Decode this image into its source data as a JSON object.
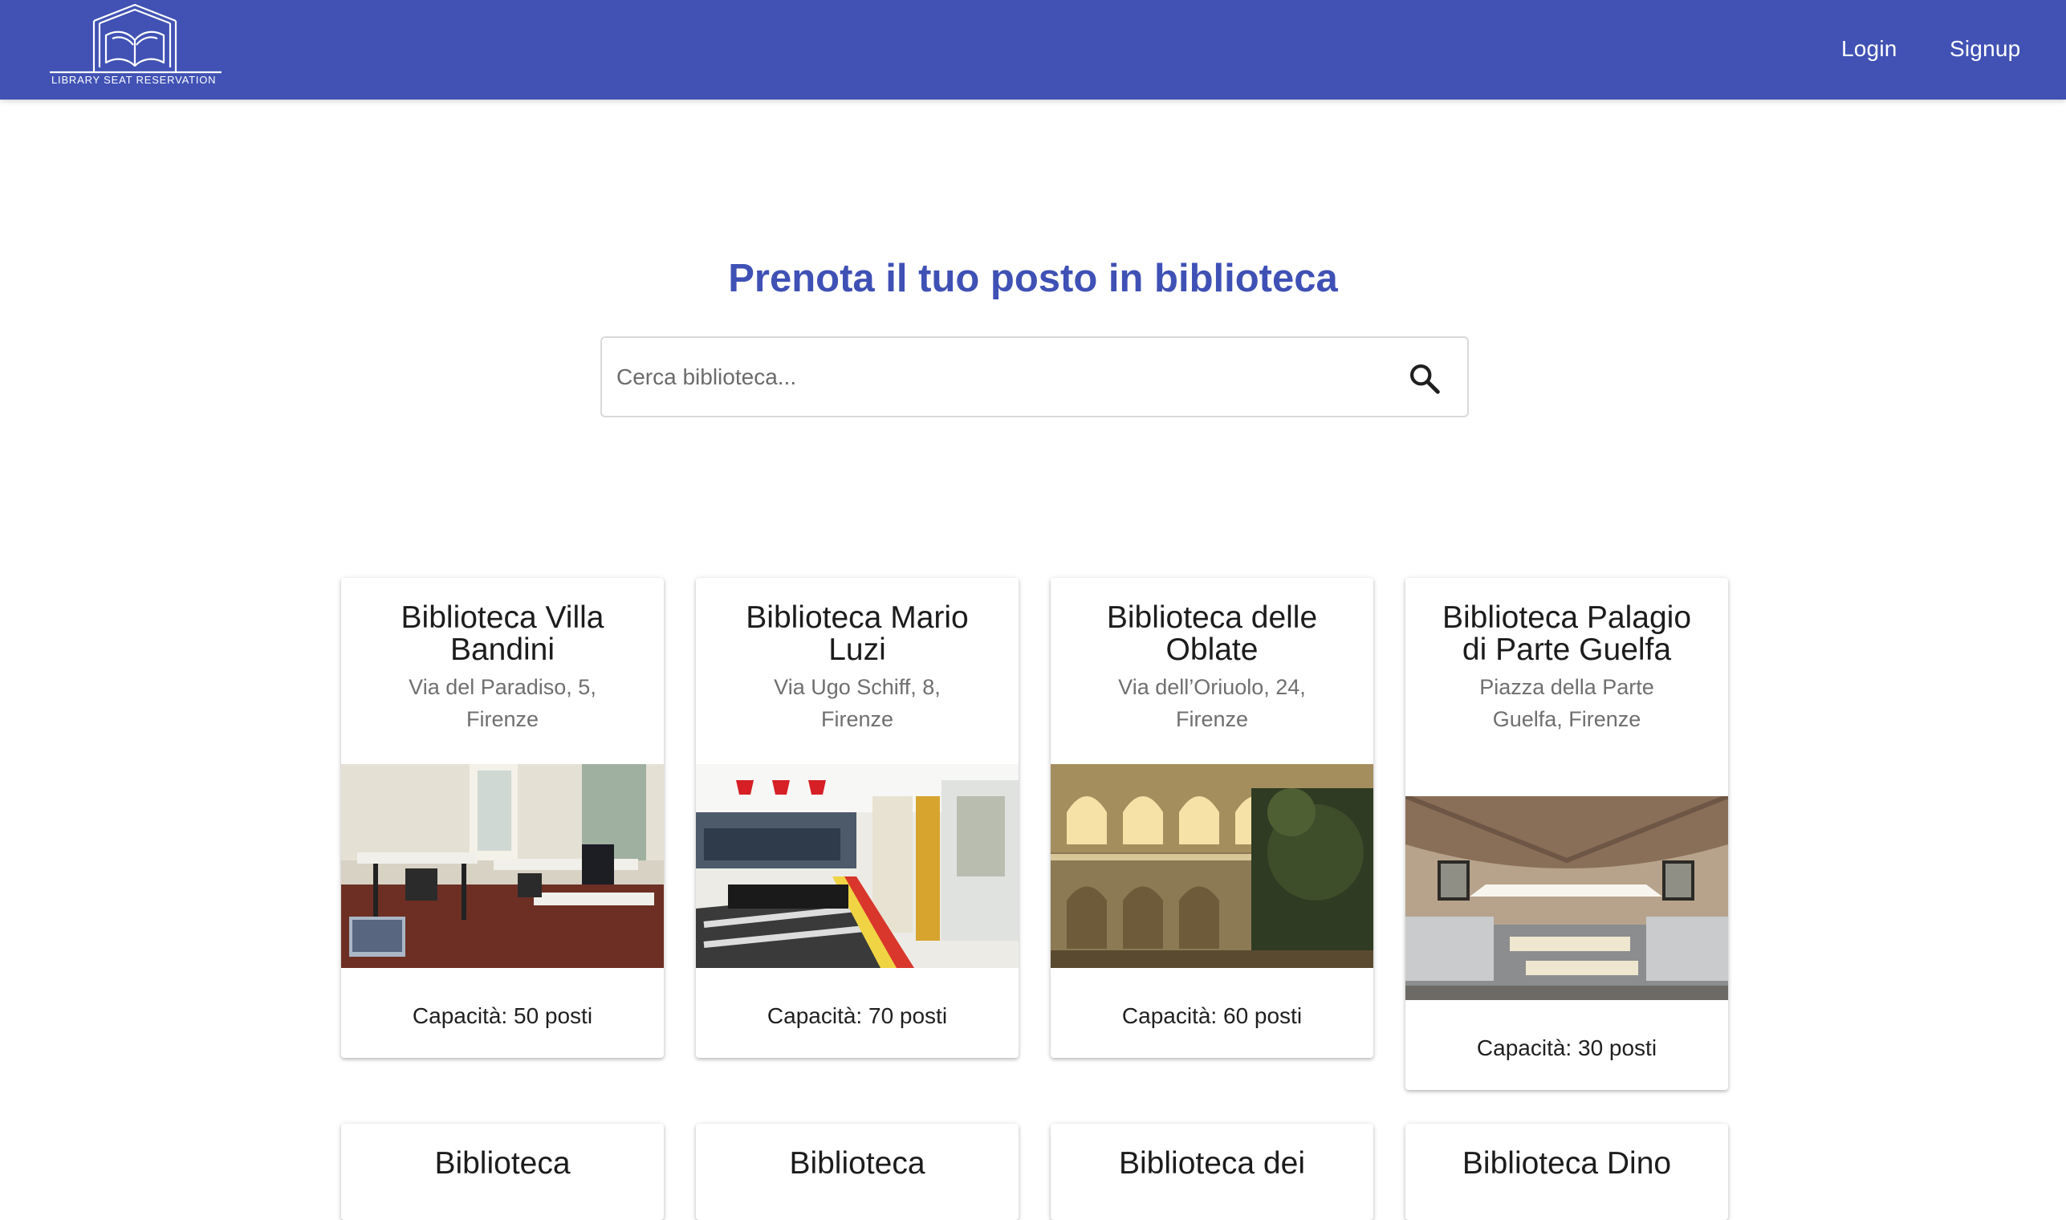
{
  "header": {
    "logo_text": "LIBRARY SEAT RESERVATION",
    "nav": [
      {
        "label": "Login"
      },
      {
        "label": "Signup"
      }
    ],
    "brand_color": "#4152b4"
  },
  "hero": {
    "title": "Prenota il tuo posto in biblioteca",
    "title_color": "#3f51b5"
  },
  "search": {
    "placeholder": "Cerca biblioteca...",
    "value": "",
    "icon": "search-icon"
  },
  "libraries": [
    {
      "name": "Biblioteca Villa Bandini",
      "address": "Via del Paradiso, 5, Firenze",
      "capacity": "Capacità: 50 posti",
      "image": "reading-room-photo"
    },
    {
      "name": "Biblioteca Mario Luzi",
      "address": "Via Ugo Schiff, 8, Firenze",
      "capacity": "Capacità: 70 posti",
      "image": "modern-library-photo"
    },
    {
      "name": "Biblioteca delle Oblate",
      "address": "Via dell’Oriuolo, 24, Firenze",
      "capacity": "Capacità: 60 posti",
      "image": "cloister-photo"
    },
    {
      "name": "Biblioteca Palagio di Parte Guelfa",
      "address": "Piazza della Parte Guelfa, Firenze",
      "capacity": "Capacità: 30 posti",
      "image": "vaulted-hall-photo"
    }
  ],
  "next_row_titles": [
    {
      "name": "Biblioteca"
    },
    {
      "name": "Biblioteca"
    },
    {
      "name": "Biblioteca dei"
    },
    {
      "name": "Biblioteca Dino"
    }
  ]
}
